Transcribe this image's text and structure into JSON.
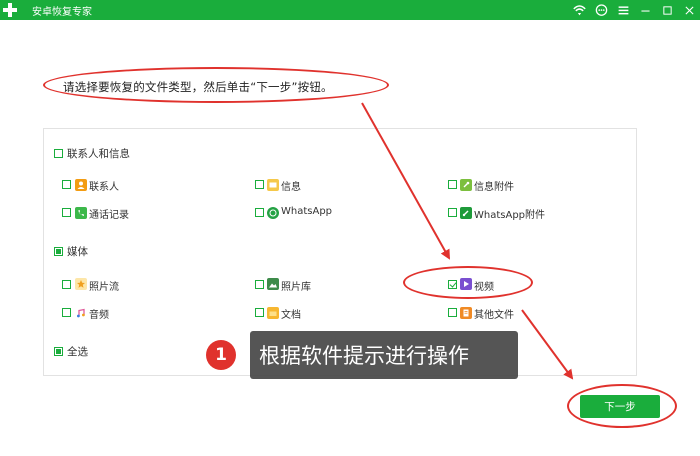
{
  "window": {
    "title": "安卓恢复专家"
  },
  "titlebar_icons": [
    "wifi-icon",
    "chat-icon",
    "menu-icon",
    "minimize-icon",
    "maximize-icon",
    "close-icon"
  ],
  "instruction": "请选择要恢复的文件类型，然后单击“下一步”按钮。",
  "groups": {
    "contacts": {
      "label": "联系人和信息",
      "state": "unchecked"
    },
    "media": {
      "label": "媒体",
      "state": "partial"
    },
    "select_all": {
      "label": "全选",
      "state": "partial"
    }
  },
  "items": {
    "contacts": {
      "label": "联系人",
      "checked": false,
      "icon": "contact-icon"
    },
    "messages": {
      "label": "信息",
      "checked": false,
      "icon": "message-icon"
    },
    "message_attachments": {
      "label": "信息附件",
      "checked": false,
      "icon": "attachment-icon"
    },
    "call_logs": {
      "label": "通话记录",
      "checked": false,
      "icon": "phone-icon"
    },
    "whatsapp": {
      "label": "WhatsApp",
      "checked": false,
      "icon": "whatsapp-icon"
    },
    "whatsapp_attachments": {
      "label": "WhatsApp附件",
      "checked": false,
      "icon": "whatsapp-attachment-icon"
    },
    "photo_stream": {
      "label": "照片流",
      "checked": false,
      "icon": "photo-stream-icon"
    },
    "photo_library": {
      "label": "照片库",
      "checked": false,
      "icon": "photo-library-icon"
    },
    "videos": {
      "label": "视频",
      "checked": true,
      "icon": "video-icon"
    },
    "audio": {
      "label": "音频",
      "checked": false,
      "icon": "audio-icon"
    },
    "documents": {
      "label": "文档",
      "checked": false,
      "icon": "folder-icon"
    },
    "other_files": {
      "label": "其他文件",
      "checked": false,
      "icon": "file-icon"
    }
  },
  "tooltip": {
    "number": "1",
    "text": "根据软件提示进行操作"
  },
  "next_button": {
    "label": "下一步"
  },
  "colors": {
    "brand_green": "#1aad3c",
    "annotation_red": "#e0322d"
  }
}
